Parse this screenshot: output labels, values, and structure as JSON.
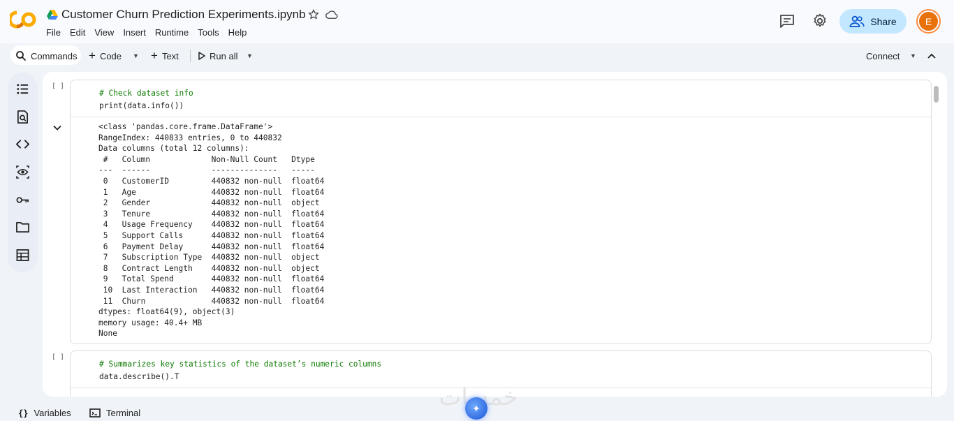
{
  "header": {
    "title": "Customer Churn Prediction Experiments.ipynb",
    "menu": [
      "File",
      "Edit",
      "View",
      "Insert",
      "Runtime",
      "Tools",
      "Help"
    ],
    "share_label": "Share",
    "avatar_initial": "E"
  },
  "toolbar": {
    "commands_label": "Commands",
    "code_label": "Code",
    "text_label": "Text",
    "run_all_label": "Run all",
    "connect_label": "Connect"
  },
  "cells": [
    {
      "bracket": "[ ]",
      "code": [
        "# Check dataset info",
        "print(data.info())"
      ],
      "output": [
        "<class 'pandas.core.frame.DataFrame'>",
        "RangeIndex: 440833 entries, 0 to 440832",
        "Data columns (total 12 columns):",
        " #   Column             Non-Null Count   Dtype  ",
        "---  ------             --------------   -----  ",
        " 0   CustomerID         440832 non-null  float64",
        " 1   Age                440832 non-null  float64",
        " 2   Gender             440832 non-null  object ",
        " 3   Tenure             440832 non-null  float64",
        " 4   Usage Frequency    440832 non-null  float64",
        " 5   Support Calls      440832 non-null  float64",
        " 6   Payment Delay      440832 non-null  float64",
        " 7   Subscription Type  440832 non-null  object ",
        " 8   Contract Length    440832 non-null  object ",
        " 9   Total Spend        440832 non-null  float64",
        " 10  Last Interaction   440832 non-null  float64",
        " 11  Churn              440832 non-null  float64",
        "dtypes: float64(9), object(3)",
        "memory usage: 40.4+ MB",
        "None"
      ]
    },
    {
      "bracket": "[ ]",
      "code": [
        "# Summarizes key statistics of the dataset’s numeric columns",
        "data.describe().T"
      ]
    }
  ],
  "statusbar": {
    "variables_label": "Variables",
    "terminal_label": "Terminal"
  },
  "watermark": {
    "text": "خمسات"
  },
  "colors": {
    "share_bg": "#c2e7ff",
    "comment": "#0b7a00",
    "accent": "#0b57d0"
  }
}
